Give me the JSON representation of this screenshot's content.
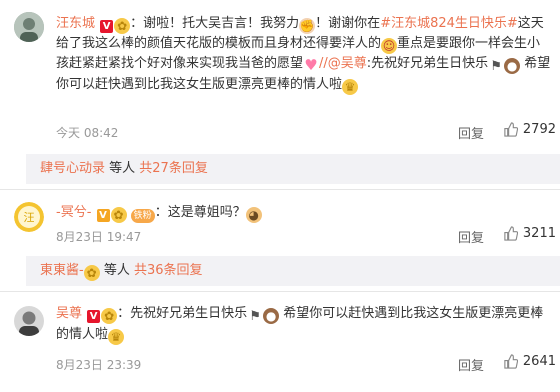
{
  "comments": [
    {
      "user": "汪东城",
      "seg1": "：谢啦！托大吴吉言！我努力",
      "seg2": "！谢谢你在",
      "hashtag": "#汪东城824生日快乐#",
      "seg3": "这天给了我这么棒的颜值天花版的模板而且身材还得要洋人的",
      "seg4": "重点是要跟你一样会生小孩赶紧赶紧找个好对像来实现我当爸的愿望",
      "mention": "//@吴尊",
      "seg5": ":先祝好兄弟生日快乐",
      "seg6": " 希望你可以赶快遇到比我这女生版更漂亮更棒的情人啦",
      "time": "今天 08:42",
      "reply": "回复",
      "likes": "2792"
    },
    {
      "user": "-冥兮-",
      "fan_badge": "铁粉",
      "seg1": "：这是尊姐吗？",
      "time": "8月23日 19:47",
      "reply": "回复",
      "likes": "3211"
    },
    {
      "user": "吴尊",
      "seg1": "：先祝好兄弟生日快乐",
      "seg2": " 希望你可以赶快遇到比我这女生版更漂亮更棒的情人啦",
      "time": "8月23日 23:39",
      "reply": "回复",
      "likes": "2641"
    }
  ],
  "sub_rows": [
    {
      "user": "肆号心动录",
      "middle": " 等人 ",
      "more": "共27条回复"
    },
    {
      "user": "東東酱-",
      "middle": " 等人 ",
      "more": "共36条回复"
    }
  ],
  "icons": [
    "vip-v-icon",
    "flower-icon",
    "muscle-emoji",
    "grin-emoji",
    "heart-emoji",
    "flag-emoji",
    "cake-emoji",
    "crown-emoji",
    "doge-emoji",
    "like-thumb-icon"
  ],
  "colors": {
    "accent": "#eb7350",
    "sub_bg": "#f2f2f5",
    "muted": "#999999"
  }
}
